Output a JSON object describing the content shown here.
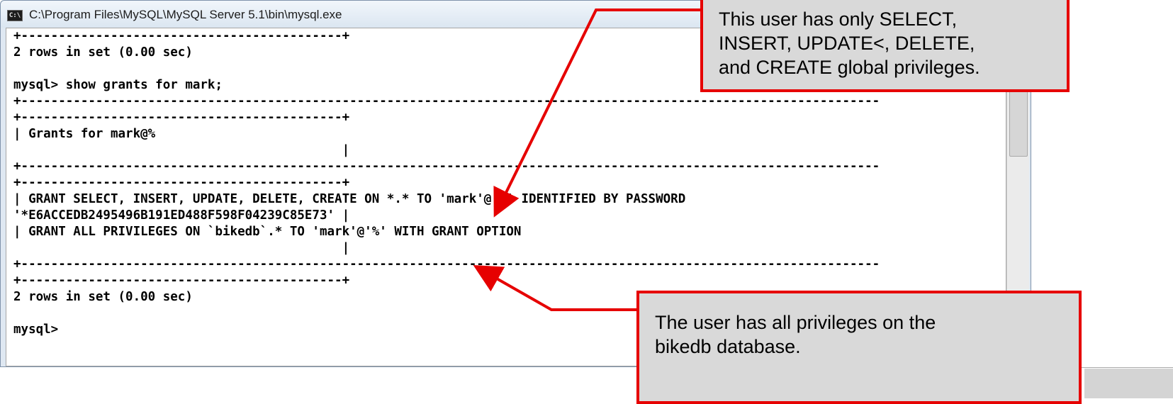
{
  "window": {
    "title": "C:\\Program Files\\MySQL\\MySQL Server 5.1\\bin\\mysql.exe",
    "icon": "console-app-icon",
    "icon_text": "C:\\"
  },
  "console": {
    "lines": [
      "+-------------------------------------------+",
      "2 rows in set (0.00 sec)",
      "",
      "mysql> show grants for mark;",
      "+-------------------------------------------------------------------------------------------------------------------",
      "+-------------------------------------------+",
      "| Grants for mark@%",
      "                                            |",
      "+-------------------------------------------------------------------------------------------------------------------",
      "+-------------------------------------------+",
      "| GRANT SELECT, INSERT, UPDATE, DELETE, CREATE ON *.* TO 'mark'@'%' IDENTIFIED BY PASSWORD",
      "'*E6ACCEDB2495496B191ED488F598F04239C85E73' |",
      "| GRANT ALL PRIVILEGES ON `bikedb`.* TO 'mark'@'%' WITH GRANT OPTION",
      "                                            |",
      "+-------------------------------------------------------------------------------------------------------------------",
      "+-------------------------------------------+",
      "2 rows in set (0.00 sec)",
      "",
      "mysql>"
    ]
  },
  "callouts": {
    "top": {
      "line1": "This user has only SELECT,",
      "line2": "INSERT, UPDATE<, DELETE,",
      "line3": "and CREATE global privileges."
    },
    "bottom": {
      "line1": "The user has all privileges on the",
      "line2": "bikedb database."
    }
  },
  "colors": {
    "callout_border": "#e60000",
    "callout_fill": "#d9d9d9",
    "arrow": "#e60000"
  }
}
